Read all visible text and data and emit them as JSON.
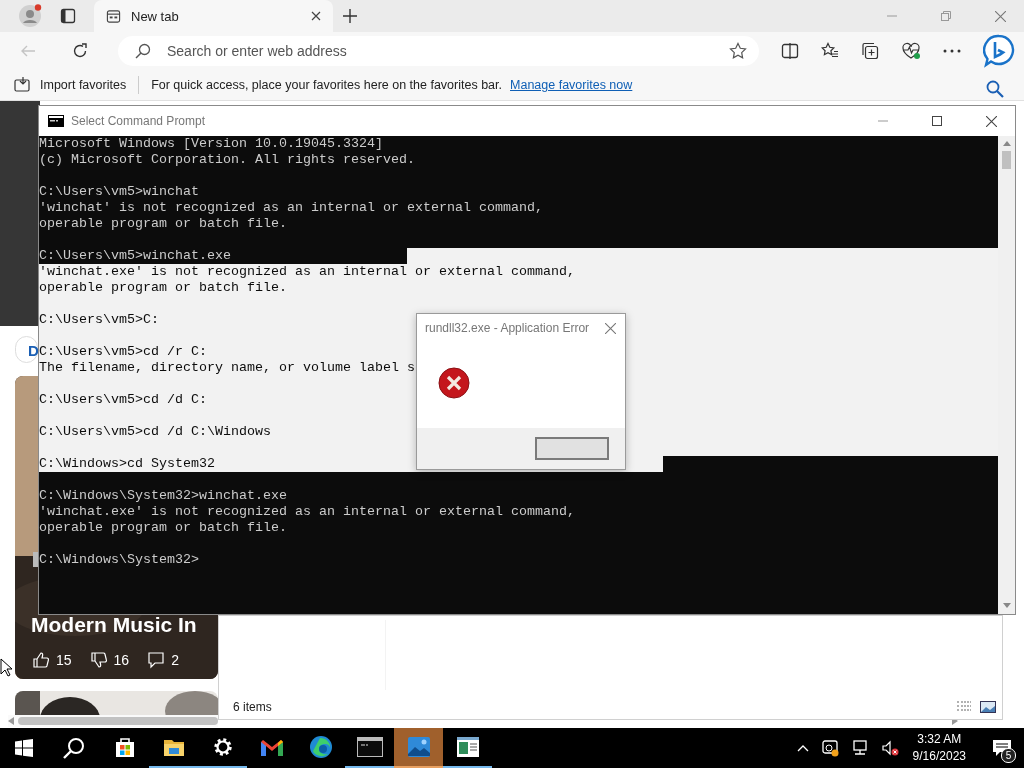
{
  "browser": {
    "tabs": [
      {
        "label": "New tab",
        "selected": true
      }
    ],
    "address_bar": {
      "placeholder": "Search or enter web address"
    },
    "favorites_bar": {
      "import_label": "Import favorites",
      "message": "For quick access, place your favorites here on the favorites bar.",
      "link": "Manage favorites now"
    },
    "content": {
      "chip": "D",
      "card": {
        "kind": "picture",
        "title": "Modern Music In",
        "likes": "15",
        "dislikes": "16",
        "comments": "2"
      }
    }
  },
  "console_window": {
    "title": "Select Command Prompt",
    "lines": [
      {
        "text": "Microsoft Windows [Version 10.0.19045.3324]",
        "selected": false
      },
      {
        "text": "(c) Microsoft Corporation. All rights reserved.",
        "selected": false
      },
      {
        "selected": false
      },
      {
        "text": "C:\\Users\\vm5>winchat",
        "selected": false
      },
      {
        "text": "'winchat' is not recognized as an internal or external command,",
        "selected": false
      },
      {
        "text": "operable program or batch file.",
        "selected": false
      },
      {
        "selected": false
      },
      {
        "text": "C:\\Users\\vm5>winchat.exe",
        "selected": true,
        "kind": "tail"
      },
      {
        "text": "'winchat.exe' is not recognized as an internal or external command,",
        "selected": true,
        "kind": "full"
      },
      {
        "text": "operable program or batch file.",
        "selected": true,
        "kind": "full"
      },
      {
        "selected": true,
        "kind": "full"
      },
      {
        "text": "C:\\Users\\vm5>C:",
        "selected": true,
        "kind": "full"
      },
      {
        "selected": true,
        "kind": "full"
      },
      {
        "text": "C:\\Users\\vm5>cd /r C:",
        "selected": true,
        "kind": "full"
      },
      {
        "text": "The filename, directory name, or volume label s",
        "selected": true,
        "kind": "full"
      },
      {
        "selected": true,
        "kind": "full"
      },
      {
        "text": "C:\\Users\\vm5>cd /d C:",
        "selected": true,
        "kind": "full"
      },
      {
        "selected": true,
        "kind": "full"
      },
      {
        "text": "C:\\Users\\vm5>cd /d C:\\Windows",
        "selected": true,
        "kind": "full"
      },
      {
        "selected": true,
        "kind": "full"
      },
      {
        "text": "C:\\Windows>cd System32",
        "selected": true,
        "kind": "head"
      },
      {
        "selected": false
      },
      {
        "text": "C:\\Windows\\System32>winchat.exe",
        "selected": false
      },
      {
        "text": "'winchat.exe' is not recognized as an internal or external command,",
        "selected": false
      },
      {
        "text": "operable program or batch file.",
        "selected": false
      },
      {
        "selected": false
      },
      {
        "text": "C:\\Windows\\System32>",
        "selected": false
      }
    ]
  },
  "error_dialog": {
    "title": "rundll32.exe - Application Error"
  },
  "explorer_window": {
    "status": "6 items"
  },
  "taskbar": {
    "apps": [
      {
        "kind": "store",
        "running": false,
        "active": false
      },
      {
        "kind": "folder",
        "running": true,
        "active": false
      },
      {
        "kind": "settings",
        "running": true,
        "active": false
      },
      {
        "kind": "mail",
        "running": false,
        "active": false
      },
      {
        "kind": "edge",
        "running": false,
        "active": false
      },
      {
        "kind": "terminal",
        "running": true,
        "active": false
      },
      {
        "kind": "photos",
        "running": true,
        "active": true
      },
      {
        "kind": "sheet",
        "running": true,
        "active": false
      }
    ],
    "time": "3:32 AM",
    "date": "9/16/2023",
    "notifications": "5"
  }
}
